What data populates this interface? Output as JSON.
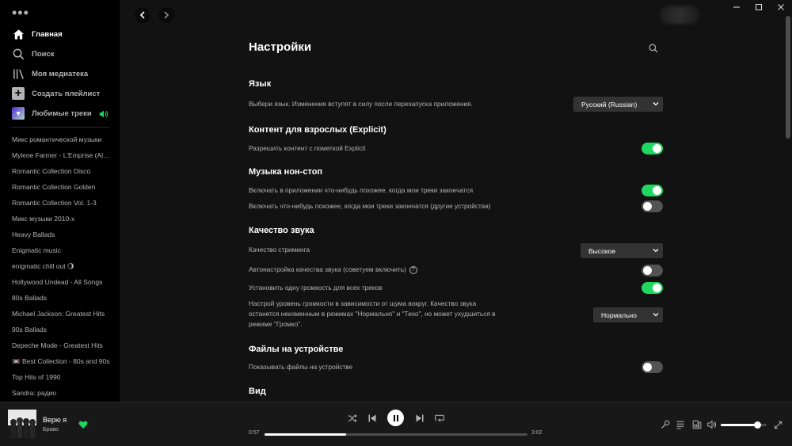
{
  "sidebar": {
    "nav": {
      "home": "Главная",
      "search": "Поиск",
      "library": "Моя медиатека",
      "create": "Создать плейлист",
      "liked": "Любимые треки"
    },
    "playlists": [
      "Микс романтической музыки",
      "Mylene Farmer - L'Emprise (Album)",
      "Romantic Collection Disco",
      "Romantic Collection Golden",
      "Romantic Collection Vol. 1-3",
      "Микс музыки 2010-х",
      "Heavy Ballads",
      "Enigmatic music",
      "enigmatic chill out 🌖",
      "Hollywood Undead - All Songs",
      "80s Ballads",
      "Michael Jackson: Greatest Hits",
      "90s Ballads",
      "Depeche Mode - Greatest Hits",
      "📼 Best Collection - 80s and 90s",
      "Top Hits of 1990",
      "Sandra: радио"
    ]
  },
  "settings": {
    "title": "Настройки",
    "language": {
      "title": "Язык",
      "label": "Выбери язык. Изменения вступят в силу после перезапуска приложения.",
      "value": "Русский (Russian)"
    },
    "explicit": {
      "title": "Контент для взрослых (Explicit)",
      "label": "Разрешить контент с пометкой Explicit",
      "on": true
    },
    "autoplay": {
      "title": "Музыка нон-стоп",
      "label1": "Включать в приложении что-нибудь похожее, когда мои треки закончатся",
      "on1": true,
      "label2": "Включать что-нибудь похожее, когда мои треки закончатся (другие устройства)",
      "on2": false
    },
    "audio": {
      "title": "Качество звука",
      "streaming_label": "Качество стриминга",
      "streaming_value": "Высокое",
      "auto_label": "Автонастройка качества звука (советуем включить)",
      "auto_on": false,
      "normalize_label": "Установить одну громкость для всех треков",
      "normalize_on": true,
      "level_line1": "Настрой уровень громкости в зависимости от шума вокруг. Качество звука",
      "level_line2": "останется неизменным в режимах \"Нормально\" и \"Тихо\", но может ухудшиться в",
      "level_line3": "режиме \"Громко\".",
      "level_value": "Нормально"
    },
    "local_files": {
      "title": "Файлы на устройстве",
      "label": "Показывать файлы на устройстве",
      "on": false
    },
    "display": {
      "title": "Вид"
    }
  },
  "player": {
    "title": "Верю я",
    "artist": "Браво",
    "current": "0:57",
    "total": "3:02",
    "progress_fraction": 0.31,
    "volume_fraction": 0.8
  },
  "colors": {
    "accent": "#1ed760",
    "background": "#121212",
    "sidebar": "#000000",
    "player": "#181818"
  }
}
